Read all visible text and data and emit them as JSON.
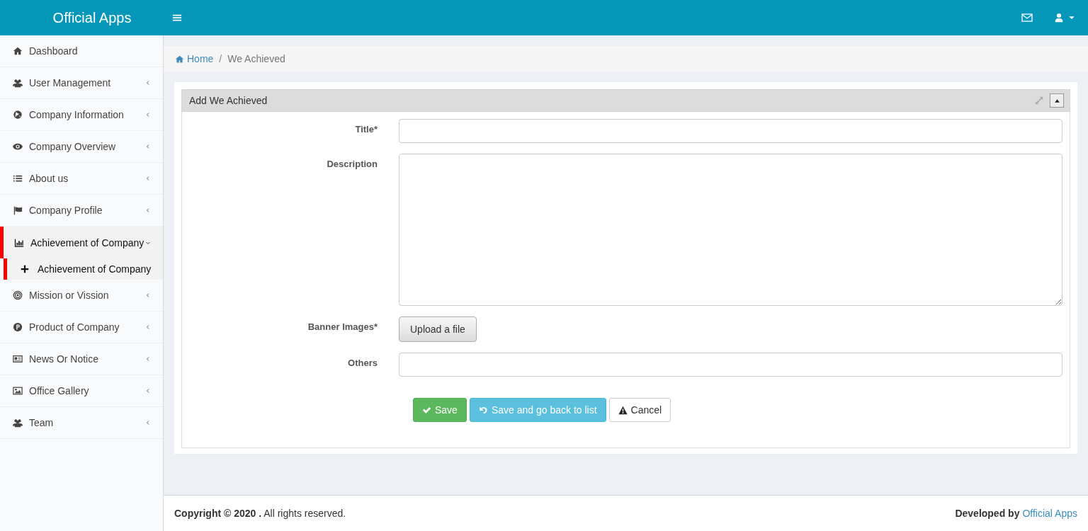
{
  "header": {
    "brand": "Official Apps"
  },
  "sidebar": {
    "items": [
      {
        "label": "Dashboard",
        "selected": false
      },
      {
        "label": "User Management",
        "selected": false,
        "expanded": false
      },
      {
        "label": "Company Information",
        "selected": false,
        "expanded": false
      },
      {
        "label": "Company Overview",
        "selected": false,
        "expanded": false
      },
      {
        "label": "About us",
        "selected": false,
        "expanded": false
      },
      {
        "label": "Company Profile",
        "selected": false,
        "expanded": false
      },
      {
        "label": "Achievement of Company",
        "selected": true,
        "expanded": true,
        "children": [
          {
            "label": "Achievement of Company",
            "selected": true
          }
        ]
      },
      {
        "label": "Mission or Vission",
        "selected": false,
        "expanded": false
      },
      {
        "label": "Product of Company",
        "selected": false,
        "expanded": false
      },
      {
        "label": "News Or Notice",
        "selected": false,
        "expanded": false
      },
      {
        "label": "Office Gallery",
        "selected": false,
        "expanded": false
      },
      {
        "label": "Team",
        "selected": false,
        "expanded": false
      }
    ]
  },
  "breadcrumb": {
    "separator": "/",
    "items": [
      {
        "label": "Home"
      },
      {
        "label": "We Achieved"
      }
    ]
  },
  "panel": {
    "title": "Add We Achieved",
    "fields": [
      {
        "kind": "text",
        "label": "Title*"
      },
      {
        "kind": "textarea",
        "label": "Description"
      },
      {
        "kind": "file",
        "label": "Banner Images*",
        "button": "Upload a file"
      },
      {
        "kind": "text",
        "label": "Others"
      }
    ],
    "buttons": [
      {
        "kind": "save",
        "label": "Save"
      },
      {
        "kind": "back",
        "label": "Save and go back to list"
      },
      {
        "kind": "cancel",
        "label": "Cancel"
      }
    ]
  },
  "footer": {
    "copyright": "**Copyright © 2020 .** All rights reserved.",
    "credit_label": "Developed by",
    "credit_link": "Official Apps"
  }
}
